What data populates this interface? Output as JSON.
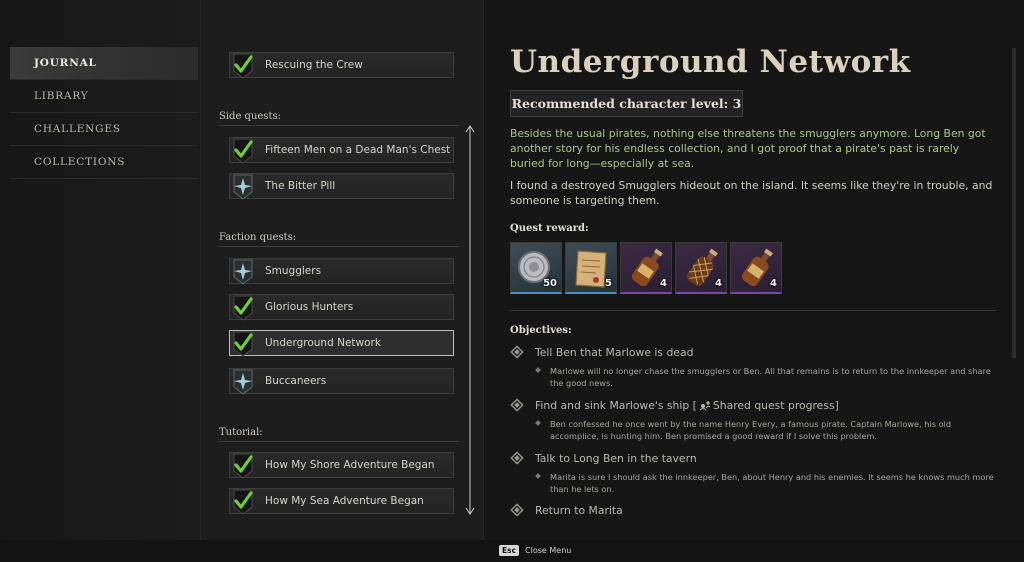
{
  "nav": {
    "items": [
      {
        "label": "Journal",
        "active": true
      },
      {
        "label": "Library",
        "active": false
      },
      {
        "label": "Challenges",
        "active": false
      },
      {
        "label": "Collections",
        "active": false
      }
    ]
  },
  "quests": {
    "main": [
      {
        "label": "Rescuing the Crew",
        "status": "completed"
      }
    ],
    "side_label": "Side quests:",
    "side": [
      {
        "label": "Fifteen Men on a Dead Man's Chest",
        "status": "completed"
      },
      {
        "label": "The Bitter Pill",
        "status": "active"
      }
    ],
    "faction_label": "Faction quests:",
    "faction": [
      {
        "label": "Smugglers",
        "status": "active"
      },
      {
        "label": "Glorious Hunters",
        "status": "completed"
      },
      {
        "label": "Underground Network",
        "status": "completed",
        "selected": true
      },
      {
        "label": "Buccaneers",
        "status": "active"
      }
    ],
    "tutorial_label": "Tutorial:",
    "tutorial": [
      {
        "label": "How My Shore Adventure Began",
        "status": "completed"
      },
      {
        "label": "How My Sea Adventure Began",
        "status": "completed"
      }
    ]
  },
  "detail": {
    "title": "Underground Network",
    "level_text": "Recommended character level: 3",
    "summary_green": "Besides the usual pirates, nothing else threatens the smugglers anymore. Long Ben got another story for his endless collection, and I got proof that a pirate's past is rarely buried for long—especially at sea.",
    "summary_white": "I found a destroyed Smugglers hideout on the island. It seems like they're in trouble, and someone is targeting them.",
    "reward_label": "Quest reward:",
    "rewards": [
      {
        "icon": "silver-coin-icon",
        "count": "50",
        "rarity": "blue"
      },
      {
        "icon": "parchment-icon",
        "count": "5",
        "rarity": "blue"
      },
      {
        "icon": "rum-bottle-icon",
        "count": "4",
        "rarity": "purple"
      },
      {
        "icon": "netted-bottle-icon",
        "count": "4",
        "rarity": "purple"
      },
      {
        "icon": "rum-bottle-icon",
        "count": "4",
        "rarity": "purple"
      }
    ],
    "objectives_label": "Objectives:",
    "objectives": [
      {
        "title": "Tell Ben that Marlowe is dead",
        "note": "Marlowe will no longer chase the smugglers or Ben. All that remains is to return to the innkeeper and share the good news."
      },
      {
        "title": "Find and sink Marlowe's ship [",
        "title_suffix": "Shared quest progress]",
        "note": "Ben confessed he once went by the name Henry Every, a famous pirate. Captain Marlowe, his old accomplice, is hunting him. Ben promised a good reward if I solve this problem."
      },
      {
        "title": "Talk to Long Ben in the tavern",
        "note": "Marita is sure I should ask the innkeeper, Ben, about Henry and his enemies. It seems he knows much more than he lets on."
      },
      {
        "title": "Return to Marita",
        "note": ""
      }
    ]
  },
  "footer": {
    "key": "Esc",
    "label": "Close Menu"
  },
  "colors": {
    "completed_check": "#6fcf3b",
    "active_icon": "#9fd0dc",
    "lore_text": "#a9c98d"
  }
}
